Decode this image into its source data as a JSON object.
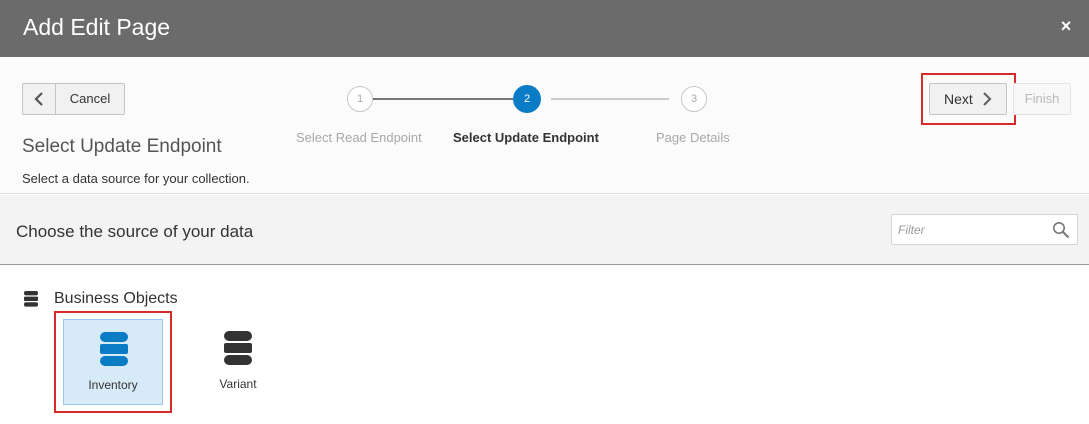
{
  "dialog": {
    "title": "Add Edit Page",
    "close_icon": "close-icon",
    "close_glyph": "×"
  },
  "toolbar": {
    "cancel_label": "Cancel",
    "next_label": "Next",
    "finish_label": "Finish"
  },
  "step": {
    "title": "Select Update Endpoint",
    "description": "Select a data source for your collection."
  },
  "train": {
    "stops": [
      {
        "number": "1",
        "label": "Select Read Endpoint",
        "state": "visited"
      },
      {
        "number": "2",
        "label": "Select Update Endpoint",
        "state": "current"
      },
      {
        "number": "3",
        "label": "Page Details",
        "state": "unvisited"
      }
    ]
  },
  "source": {
    "title": "Choose the source of your data",
    "filter_placeholder": "Filter",
    "filter_value": ""
  },
  "section": {
    "title": "Business Objects",
    "icon": "database-icon"
  },
  "tiles": [
    {
      "label": "Inventory",
      "icon": "database-icon",
      "selected": true
    },
    {
      "label": "Variant",
      "icon": "database-icon",
      "selected": false
    }
  ],
  "colors": {
    "titlebar": "#6b6b6b",
    "accent": "#0a7cc6",
    "highlight": "#d62b2b",
    "selected_tile": "#d7eaf8"
  }
}
